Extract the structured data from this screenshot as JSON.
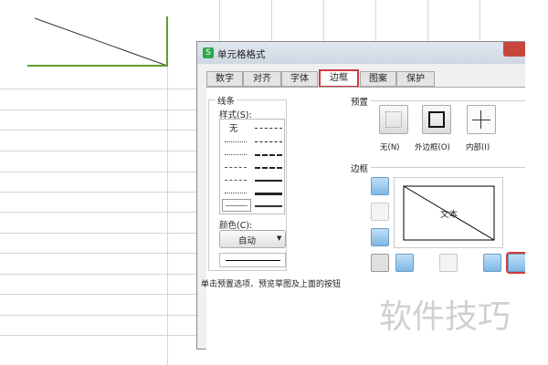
{
  "dialog": {
    "title": "单元格格式",
    "app_icon": "S",
    "close_icon": "close-icon",
    "tabs": [
      {
        "label": "数字"
      },
      {
        "label": "对齐"
      },
      {
        "label": "字体"
      },
      {
        "label": "边框",
        "active": true
      },
      {
        "label": "图案"
      },
      {
        "label": "保护"
      }
    ],
    "line": {
      "group_label": "线条",
      "style_label": "样式(S):",
      "none_label": "无",
      "color_label": "颜色(C):",
      "color_value": "自动"
    },
    "preset": {
      "group_label": "预置",
      "items": [
        {
          "label": "无(N)"
        },
        {
          "label": "外边框(O)"
        },
        {
          "label": "内部(I)"
        }
      ]
    },
    "border": {
      "group_label": "边框",
      "preview_text": "文本"
    },
    "hint": "单击预置选项、预览草图及上面的按钮"
  },
  "watermark": "软件技巧",
  "colors": {
    "highlight": "#d23a3a",
    "cell_border": "#5aa02c"
  }
}
